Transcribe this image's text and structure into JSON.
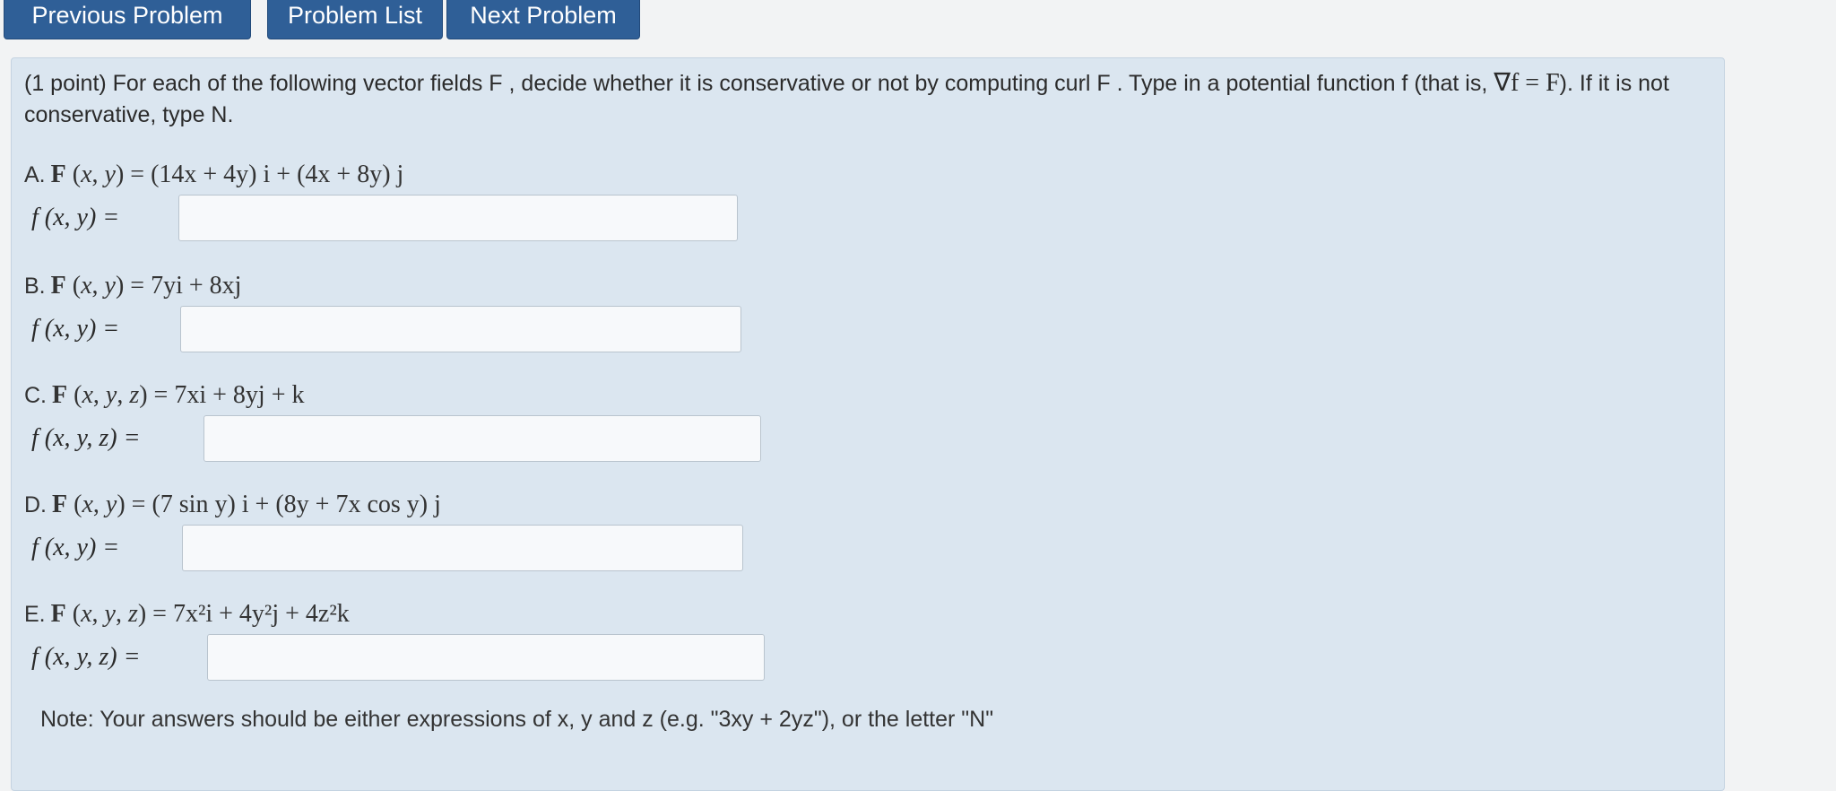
{
  "nav": {
    "previous_label": "Previous Problem",
    "list_label": "Problem List",
    "next_label": "Next Problem"
  },
  "prompt": {
    "before": "(1 point) For each of the following vector fields F , decide whether it is conservative or not by computing curl F . Type in a potential function f (that is, ",
    "grad_expr": "∇f = F",
    "after": "). If it is not conservative, type N."
  },
  "problems": [
    {
      "label": "A.",
      "field_expr": "(14x + 4y) i + (4x + 8y) j",
      "answer_label": "f (x, y) =",
      "answer_value": ""
    },
    {
      "label": "B.",
      "field_expr": "7yi + 8xj",
      "answer_label": "f (x, y) =",
      "answer_value": ""
    },
    {
      "label": "C.",
      "field_expr": "7xi + 8yj + k",
      "answer_label": "f (x, y, z) =",
      "answer_value": ""
    },
    {
      "label": "D.",
      "field_expr": "(7 sin y) i + (8y + 7x cos y) j",
      "answer_label": "f (x, y) =",
      "answer_value": ""
    },
    {
      "label": "E.",
      "field_expr": "7x²i + 4y²j + 4z²k",
      "answer_label": "f (x, y, z) =",
      "answer_value": ""
    }
  ],
  "note": "Note: Your answers should be either expressions of x, y and z (e.g. \"3xy + 2yz\"), or the letter \"N\""
}
